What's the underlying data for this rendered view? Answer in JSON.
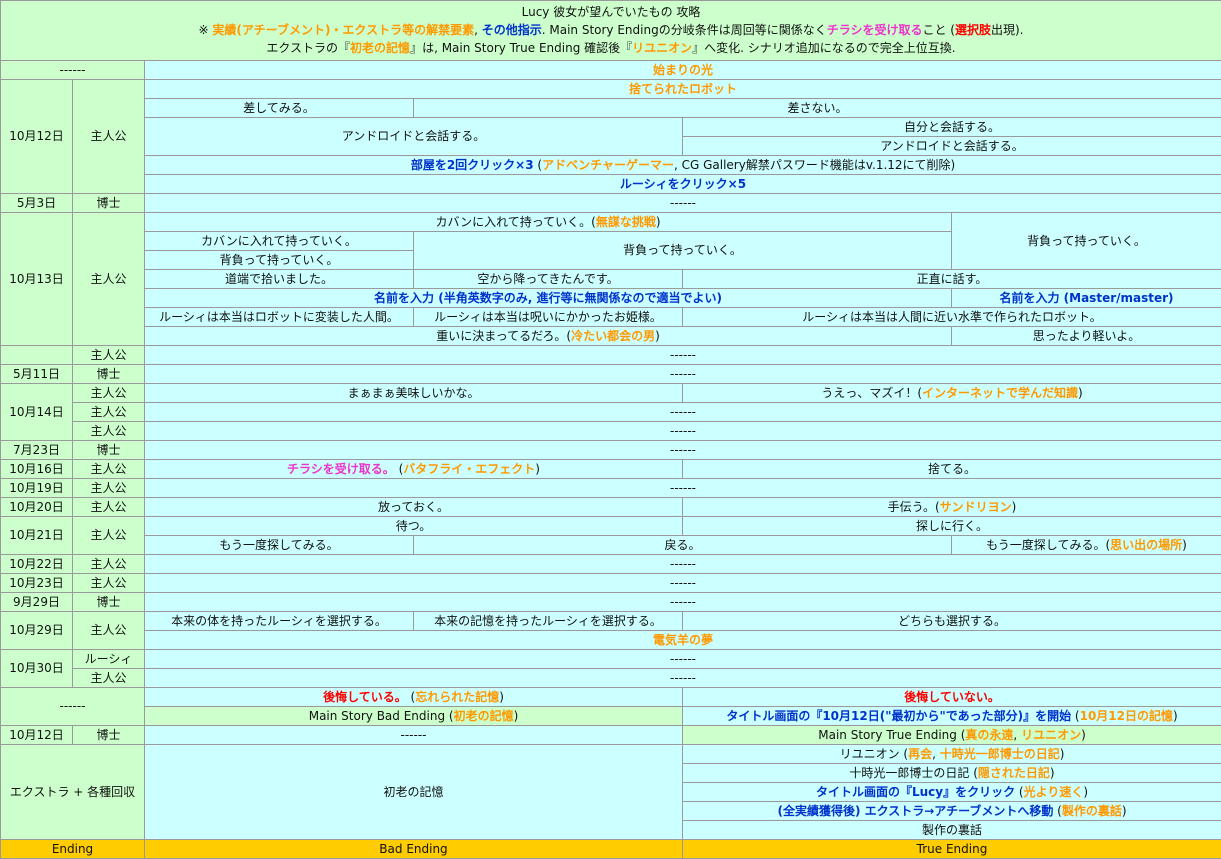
{
  "header": {
    "line1": "Lucy 彼女が望んでいたもの 攻略",
    "line2": {
      "a": "※ ",
      "b": "実績(アチーブメント)・エクストラ等の解禁要素",
      "c": ", ",
      "d": "その他指示",
      "e": ". Main Story Endingの分岐条件は周回等に関係なく",
      "f": "チラシを受け取る",
      "g": "こと (",
      "h": "選択肢",
      "i": "出現)."
    },
    "line3": {
      "a": "エクストラの『",
      "b": "初老の記憶",
      "c": "』は, Main Story True Ending 確認後『",
      "d": "リユニオン",
      "e": "』へ変化. シナリオ追加になるので完全上位互換."
    }
  },
  "dashes": "------",
  "chapters": {
    "c1": "始まりの光",
    "c2": "捨てられたロボット",
    "c3": "電気羊の夢"
  },
  "dates": {
    "oct12": "10月12日",
    "may3": "5月3日",
    "oct13": "10月13日",
    "may11": "5月11日",
    "oct14": "10月14日",
    "jul23": "7月23日",
    "oct16": "10月16日",
    "oct19": "10月19日",
    "oct20": "10月20日",
    "oct21": "10月21日",
    "oct22": "10月22日",
    "oct23": "10月23日",
    "sep29": "9月29日",
    "oct29": "10月29日",
    "oct30": "10月30日",
    "oct12b": "10月12日"
  },
  "chars": {
    "hero": "主人公",
    "doctor": "博士",
    "lucy": "ルーシィ"
  },
  "oct12": {
    "r2a": "差してみる。",
    "r2b": "差さない。",
    "r3a": "アンドロイドと会話する。",
    "r3b": "自分と会話する。",
    "r4b": "アンドロイドと会話する。",
    "r5": {
      "a": "部屋を2回クリック×3",
      "b": " (",
      "c": "アドベンチャーゲーマー",
      "d": ", CG Gallery解禁パスワード機能はv.1.12にて削除)"
    },
    "r6": "ルーシィをクリック×5"
  },
  "oct13": {
    "r1": {
      "a": "カバンに入れて持っていく。(",
      "b": "無謀な挑戦",
      "c": ")"
    },
    "r1d": "背負って持っていく。",
    "r2a": "カバンに入れて持っていく。",
    "r2b": "背負って持っていく。",
    "r3a": "背負って持っていく。",
    "r4a": "道端で拾いました。",
    "r4b": "空から降ってきたんです。",
    "r4c": "正直に話す。",
    "r5a": "名前を入力 (半角英数字のみ, 進行等に無関係なので適当でよい)",
    "r5b": "名前を入力 (Master/master)",
    "r6a": "ルーシィは本当はロボットに変装した人間。",
    "r6b": "ルーシィは本当は呪いにかかったお姫様。",
    "r6c": "ルーシィは本当は人間に近い水準で作られたロボット。",
    "r7": {
      "a": "重いに決まってるだろ。(",
      "b": "冷たい都会の男",
      "c": ")"
    },
    "r7b": "思ったより軽いよ。"
  },
  "oct14": {
    "a": "まぁまぁ美味しいかな。",
    "b": {
      "a": "うえっ、マズイ！(",
      "b": "インターネットで学んだ知識",
      "c": ")"
    }
  },
  "oct16": {
    "a": {
      "a": "チラシを受け取る。",
      "b": " (",
      "c": "バタフライ・エフェクト",
      "d": ")"
    },
    "b": "捨てる。"
  },
  "oct20": {
    "a": "放っておく。",
    "b": {
      "a": "手伝う。(",
      "b": "サンドリヨン",
      "c": ")"
    }
  },
  "oct21": {
    "a": "待つ。",
    "b": "探しに行く。",
    "c": "もう一度探してみる。",
    "d": "戻る。",
    "e": {
      "a": "もう一度探してみる。(",
      "b": "思い出の場所",
      "c": ")"
    }
  },
  "oct29": {
    "a": "本来の体を持ったルーシィを選択する。",
    "b": "本来の記憶を持ったルーシィを選択する。",
    "c": "どちらも選択する。"
  },
  "endings": {
    "bad1": {
      "a": "後悔している。",
      "b": " (",
      "c": "忘れられた記憶",
      "d": ")"
    },
    "true1": "後悔していない。",
    "bad2": {
      "a": "Main Story Bad Ending (",
      "b": "初老の記憶",
      "c": ")"
    },
    "true2": {
      "a": "タイトル画面の『10月12日(\"最初から\"であった部分)』を開始",
      "b": " (",
      "c": "10月12日の記憶",
      "d": ")"
    },
    "true3": "Main Story True Ending (",
    "true3b": "真の永遠",
    "true3c": ", ",
    "true3d": "リユニオン",
    "true3e": ")"
  },
  "extra": {
    "label": "エクストラ + 各種回収",
    "bad": "初老の記憶",
    "t1": {
      "a": "リユニオン (",
      "b": "再会",
      "c": ", ",
      "d": "十時光一郎博士の日記",
      "e": ")"
    },
    "t2": {
      "a": "十時光一郎博士の日記 (",
      "b": "隠された日記",
      "c": ")"
    },
    "t3": {
      "a": "タイトル画面の『Lucy』をクリック",
      "b": " (",
      "c": "光より速く",
      "d": ")"
    },
    "t4": {
      "a": "(全実績獲得後) エクストラ→アチーブメントへ移動",
      "b": " (",
      "c": "製作の裏話",
      "d": ")"
    },
    "t5": "製作の裏話"
  },
  "footer": {
    "a": "Ending",
    "b": "Bad Ending",
    "c": "True Ending"
  }
}
